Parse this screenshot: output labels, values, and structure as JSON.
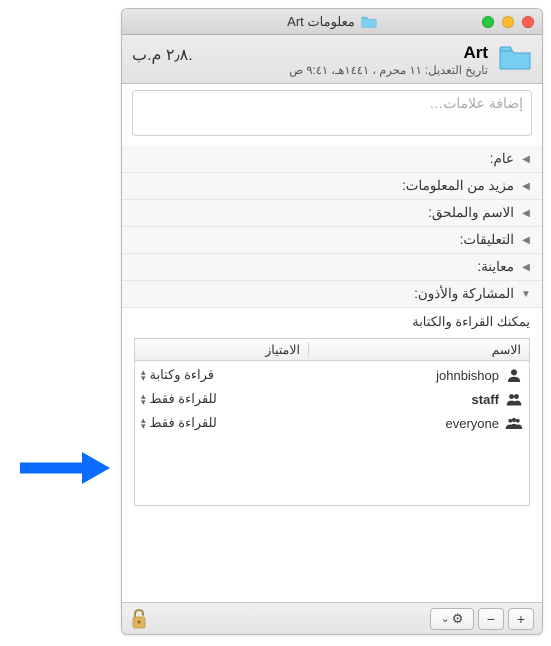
{
  "window": {
    "title": "معلومات Art"
  },
  "header": {
    "name": "Art",
    "size": "٢٫٨ م.ب.",
    "modified": "تاريخ التعديل: ١١ محرم ، ١٤٤١هـ، ٩:٤١ ص"
  },
  "tags": {
    "placeholder": "إضافة علامات…"
  },
  "sections": {
    "general": "عام:",
    "more": "مزيد من المعلومات:",
    "nameext": "الاسم والملحق:",
    "comments": "التعليقات:",
    "preview": "معاينة:",
    "sharing": "المشاركة والأذون:"
  },
  "permissions": {
    "summary": "يمكنك القراءة والكتابة",
    "header": {
      "name": "الاسم",
      "priv": "الامتياز"
    },
    "rows": [
      {
        "user": "johnbishop",
        "priv": "قراءة وكتابة",
        "icon": "single"
      },
      {
        "user": "staff",
        "priv": "للقراءة فقط",
        "icon": "double"
      },
      {
        "user": "everyone",
        "priv": "للقراءة فقط",
        "icon": "group"
      }
    ]
  },
  "footer": {
    "add": "+",
    "remove": "−",
    "gear": "⚙",
    "chevron": "⌄"
  }
}
